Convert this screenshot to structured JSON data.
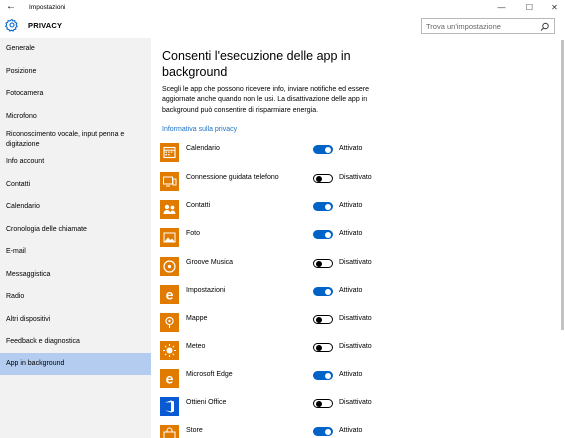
{
  "window": {
    "title": "Impostazioni",
    "back_glyph": "←",
    "minimize_glyph": "—",
    "maximize_glyph": "☐",
    "close_glyph": "✕"
  },
  "header": {
    "section_title": "PRIVACY",
    "icon": "gear-icon",
    "search_placeholder": "Trova un'impostazione"
  },
  "sidebar": {
    "items": [
      {
        "label": "Generale"
      },
      {
        "label": "Posizione"
      },
      {
        "label": "Fotocamera"
      },
      {
        "label": "Microfono"
      },
      {
        "label": "Riconoscimento vocale, input penna e digitazione"
      },
      {
        "label": "Info account"
      },
      {
        "label": "Contatti"
      },
      {
        "label": "Calendario"
      },
      {
        "label": "Cronologia delle chiamate"
      },
      {
        "label": "E-mail"
      },
      {
        "label": "Messaggistica"
      },
      {
        "label": "Radio"
      },
      {
        "label": "Altri dispositivi"
      },
      {
        "label": "Feedback e diagnostica"
      },
      {
        "label": "App in background",
        "selected": true
      }
    ]
  },
  "main": {
    "title": "Consenti l'esecuzione delle app in background",
    "description": "Scegli le app che possono ricevere info, inviare notifiche ed essere aggiornate anche quando non le usi. La disattivazione delle app in background può consentire di risparmiare energia.",
    "privacy_link": "Informativa sulla privacy",
    "apps": [
      {
        "name": "Calendario",
        "on": true,
        "state": "Attivato",
        "icon": "calendar-icon",
        "color": "#e07b00"
      },
      {
        "name": "Connessione guidata telefono",
        "on": false,
        "state": "Disattivato",
        "icon": "phone-companion-icon",
        "color": "#e07b00"
      },
      {
        "name": "Contatti",
        "on": true,
        "state": "Attivato",
        "icon": "people-icon",
        "color": "#e07b00"
      },
      {
        "name": "Foto",
        "on": true,
        "state": "Attivato",
        "icon": "photos-icon",
        "color": "#e07b00"
      },
      {
        "name": "Groove Musica",
        "on": false,
        "state": "Disattivato",
        "icon": "groove-music-icon",
        "color": "#e07b00"
      },
      {
        "name": "Impostazioni",
        "on": true,
        "state": "Attivato",
        "icon": "edge-e-icon",
        "color": "#e07b00"
      },
      {
        "name": "Mappe",
        "on": false,
        "state": "Disattivato",
        "icon": "maps-icon",
        "color": "#e07b00"
      },
      {
        "name": "Meteo",
        "on": false,
        "state": "Disattivato",
        "icon": "weather-icon",
        "color": "#e07b00"
      },
      {
        "name": "Microsoft Edge",
        "on": true,
        "state": "Attivato",
        "icon": "edge-e-icon",
        "color": "#e07b00"
      },
      {
        "name": "Ottieni Office",
        "on": false,
        "state": "Disattivato",
        "icon": "office-icon",
        "color": "#0a5bd3"
      },
      {
        "name": "Store",
        "on": true,
        "state": "Attivato",
        "icon": "store-icon",
        "color": "#e07b00"
      }
    ]
  },
  "colors": {
    "accent": "#0063c8",
    "sidebar_bg": "#f2f2f2",
    "selected_bg": "#b3ccf0",
    "link": "#1a73c7",
    "app_tile": "#e07b00",
    "office_tile": "#0a5bd3"
  }
}
